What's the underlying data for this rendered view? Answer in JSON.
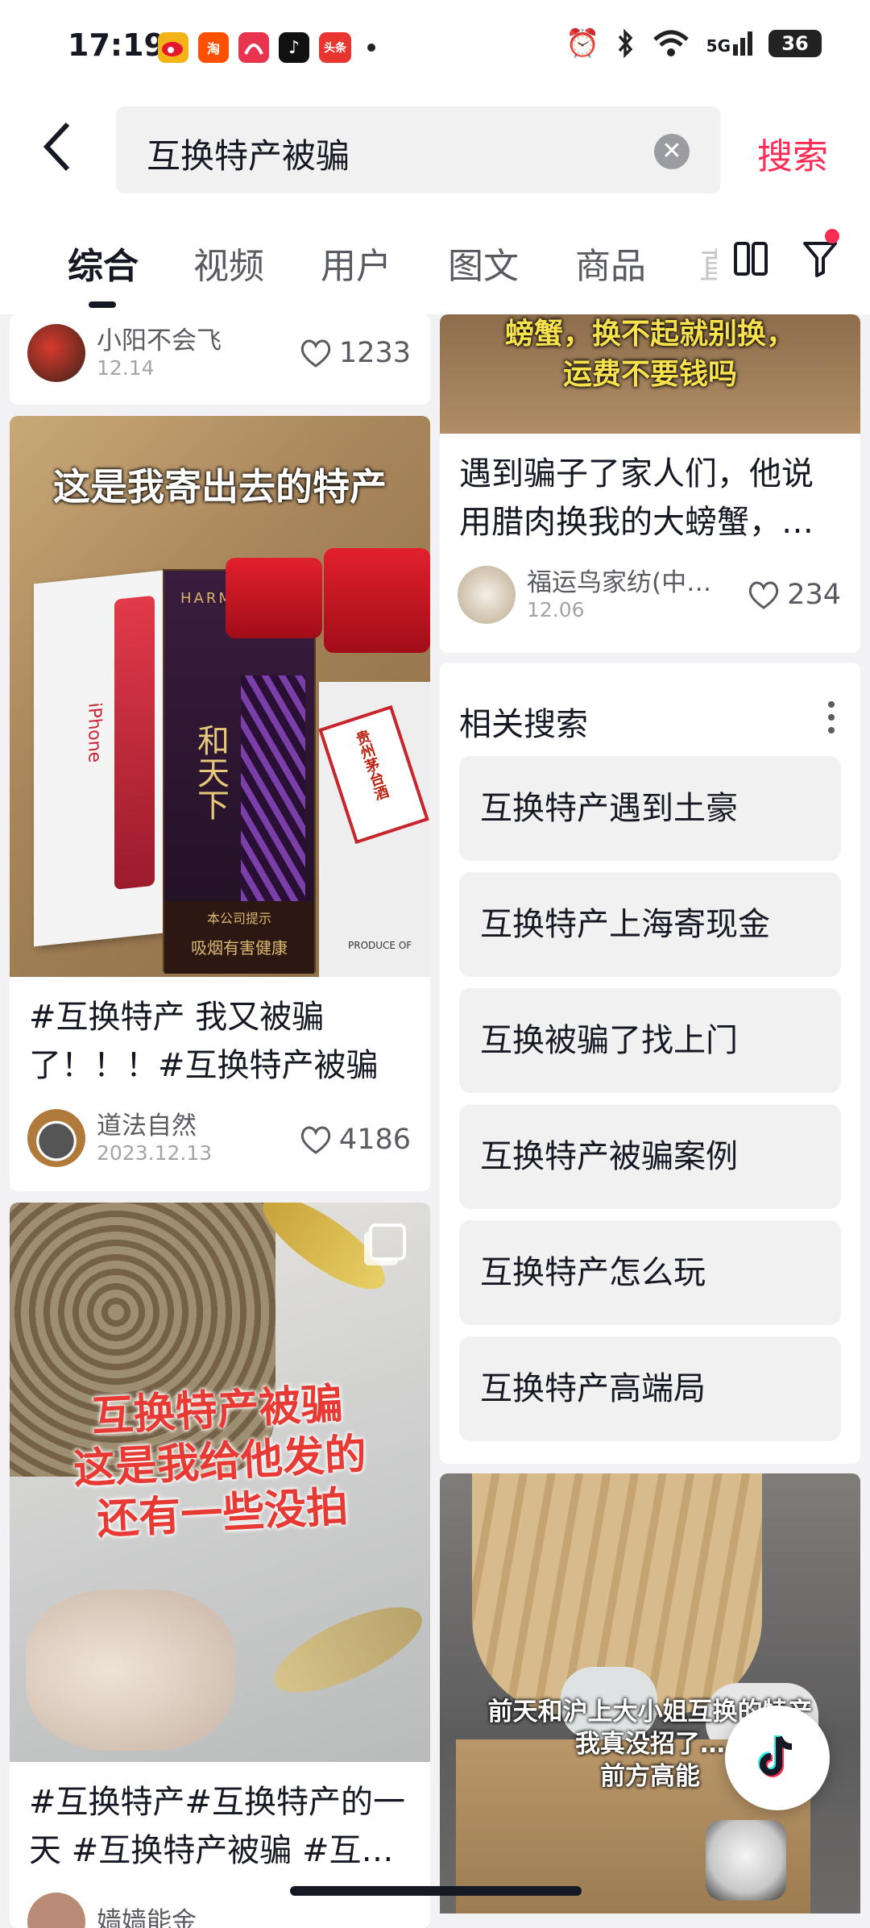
{
  "status_bar": {
    "time": "17:19",
    "app_icons": [
      "weibo-icon",
      "taobao-icon",
      "app-icon",
      "douyin-icon",
      "toutiao-icon"
    ],
    "toutiao_label": "头条",
    "taobao_label": "淘",
    "battery": "36",
    "network": "5G"
  },
  "search": {
    "query": "互换特产被骗",
    "button": "搜索"
  },
  "tabs": [
    "综合",
    "视频",
    "用户",
    "图文",
    "商品",
    "直"
  ],
  "left_column": {
    "card1": {
      "author": "小阳不会飞",
      "date": "12.14",
      "likes": "1233"
    },
    "card2": {
      "overlay": "这是我寄出去的特产",
      "title_line1": "#互换特产 我又被骗",
      "title_line2": "了！！！#互换特产被骗",
      "author": "道法自然",
      "date": "2023.12.13",
      "likes": "4186",
      "box_labels": {
        "iphone": "iPhone",
        "harmony": "HARMO",
        "liquor": "贵州茅台酒",
        "notice": "本公司提示",
        "warning": "吸烟有害健康",
        "produce": "PRODUCE OF",
        "brand": "和天下"
      }
    },
    "card3": {
      "overlay_line1": "互换特产被骗",
      "overlay_line2": "这是我给他发的",
      "overlay_line3": "还有一些没拍",
      "title_line1": "#互换特产#互换特产的一",
      "title_line2": "天 #互换特产被骗 #互…",
      "author": "嫱嫱能金"
    }
  },
  "right_column": {
    "card1": {
      "overlay_line1": "螃蟹，换不起就别换，",
      "overlay_line2": "运费不要钱吗",
      "title_line1": "遇到骗子了家人们，他说",
      "title_line2": "用腊肉换我的大螃蟹，…",
      "author": "福运鸟家纺(中…",
      "date": "12.06",
      "likes": "234"
    },
    "related": {
      "title": "相关搜索",
      "items": [
        "互换特产遇到土豪",
        "互换特产上海寄现金",
        "互换被骗了找上门",
        "互换特产被骗案例",
        "互换特产怎么玩",
        "互换特产高端局"
      ]
    },
    "card2": {
      "overlay_line1": "前天和沪上大小姐互换的特产",
      "overlay_line2": "我真没招了…",
      "overlay_line3": "前方高能"
    }
  },
  "colors": {
    "accent": "#fe2c55",
    "text": "#161823",
    "subtle": "#5a5b62",
    "bg": "#f2f2f4"
  }
}
